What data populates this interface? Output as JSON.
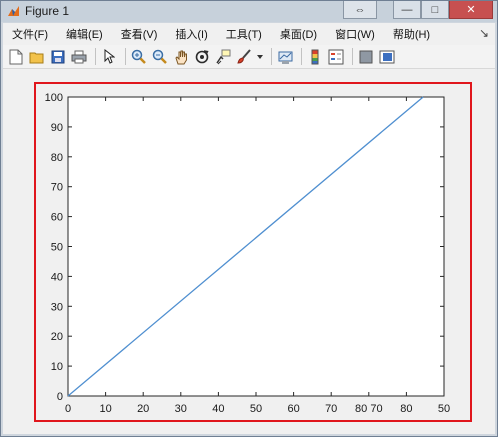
{
  "window": {
    "title": "Figure 1",
    "minimize": "—",
    "maximize": "□",
    "close": "✕",
    "extra": "⇔"
  },
  "menu": {
    "items": [
      "文件(F)",
      "编辑(E)",
      "查看(V)",
      "插入(I)",
      "工具(T)",
      "桌面(D)",
      "窗口(W)",
      "帮助(H)"
    ],
    "right_symbol": "↘"
  },
  "toolbar": {
    "icons": [
      "new-figure-icon",
      "open-file-icon",
      "save-icon",
      "print-icon",
      "pointer-icon",
      "zoom-in-icon",
      "zoom-out-icon",
      "pan-hand-icon",
      "rotate-3d-icon",
      "data-cursor-icon",
      "brush-icon",
      "link-plot-icon",
      "insert-colorbar-icon",
      "insert-legend-icon",
      "hide-plot-tools-icon",
      "show-plot-tools-icon"
    ]
  },
  "chart_data": {
    "type": "line",
    "x": [
      0,
      85
    ],
    "y": [
      0,
      100
    ],
    "xlim": [
      0,
      90
    ],
    "ylim": [
      0,
      100
    ],
    "xticks": [
      "0",
      "10",
      "20",
      "30",
      "40",
      "50",
      "60",
      "70",
      "80 70",
      "80",
      "50"
    ],
    "yticks": [
      "0",
      "10",
      "20",
      "30",
      "40",
      "50",
      "60",
      "70",
      "80",
      "90",
      "100"
    ],
    "line_color": "#4f8fd0",
    "grid": false
  }
}
